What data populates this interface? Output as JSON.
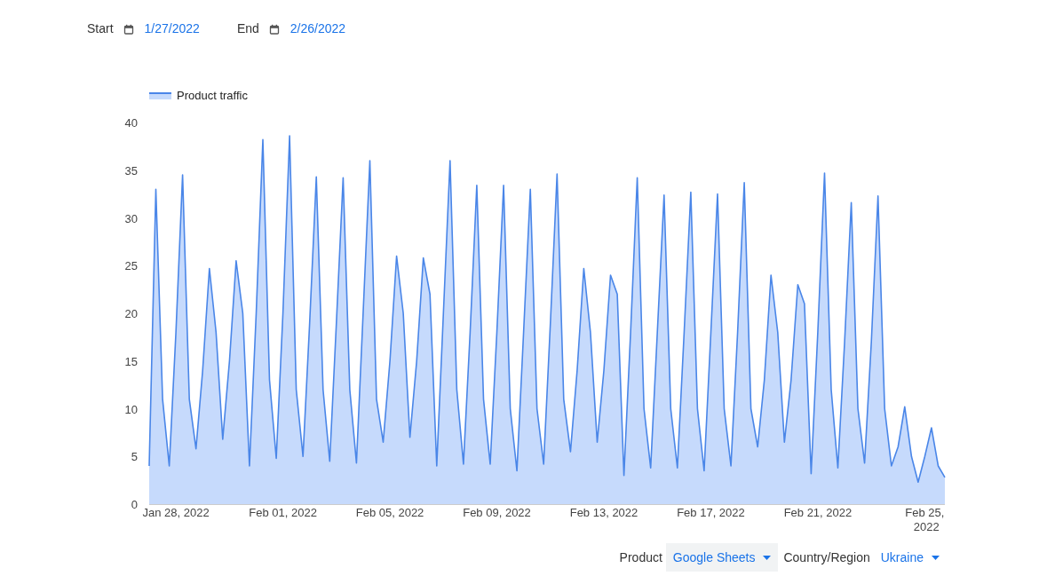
{
  "date_range": {
    "start_label": "Start",
    "start_value": "1/27/2022",
    "end_label": "End",
    "end_value": "2/26/2022"
  },
  "chart": {
    "chart_data": {
      "type": "area",
      "ylim": [
        0,
        40
      ],
      "yticks": [
        0,
        5,
        10,
        15,
        20,
        25,
        30,
        35,
        40
      ],
      "categories": [
        null,
        null,
        null,
        null,
        "Jan 28, 2022",
        null,
        null,
        null,
        null,
        null,
        null,
        null,
        null,
        null,
        null,
        null,
        null,
        null,
        null,
        null,
        "Feb 01, 2022",
        null,
        null,
        null,
        null,
        null,
        null,
        null,
        null,
        null,
        null,
        null,
        null,
        null,
        null,
        null,
        "Feb 05, 2022",
        null,
        null,
        null,
        null,
        null,
        null,
        null,
        null,
        null,
        null,
        null,
        null,
        null,
        null,
        null,
        "Feb 09, 2022",
        null,
        null,
        null,
        null,
        null,
        null,
        null,
        null,
        null,
        null,
        null,
        null,
        null,
        null,
        null,
        "Feb 13, 2022",
        null,
        null,
        null,
        null,
        null,
        null,
        null,
        null,
        null,
        null,
        null,
        null,
        null,
        null,
        null,
        "Feb 17, 2022",
        null,
        null,
        null,
        null,
        null,
        null,
        null,
        null,
        null,
        null,
        null,
        null,
        null,
        null,
        null,
        "Feb 21, 2022",
        null,
        null,
        null,
        null,
        null,
        null,
        null,
        null,
        null,
        null,
        null,
        null,
        null,
        null,
        null,
        "Feb 25, 2022",
        null,
        null,
        null
      ],
      "series": [
        {
          "name": "Product traffic",
          "color": "#4a86e8",
          "values": [
            4,
            33,
            11,
            4,
            18,
            34.5,
            11,
            5.8,
            14,
            24.7,
            18,
            6.8,
            15,
            25.5,
            20,
            4,
            20,
            38.2,
            13,
            4.8,
            20,
            38.6,
            12,
            5,
            19,
            34.3,
            12,
            4.5,
            19,
            34.2,
            12,
            4.3,
            20,
            36,
            11,
            6.5,
            15,
            26,
            20,
            7,
            15,
            25.8,
            22,
            4,
            20,
            36,
            12,
            4.2,
            18,
            33.4,
            11,
            4.2,
            18,
            33.4,
            10,
            3.5,
            18,
            33,
            10,
            4.2,
            19,
            34.6,
            11,
            5.5,
            14,
            24.7,
            18,
            6.5,
            14,
            24,
            22,
            3,
            18,
            34.2,
            10,
            3.8,
            18,
            32.4,
            10,
            3.8,
            18,
            32.7,
            10,
            3.5,
            18,
            32.5,
            10,
            4,
            18,
            33.7,
            10,
            6,
            13,
            24,
            18,
            6.5,
            13,
            23,
            21,
            3.2,
            18,
            34.7,
            12,
            3.8,
            17,
            31.6,
            10,
            4.3,
            17,
            32.3,
            10,
            4,
            6,
            10.2,
            5,
            2.3,
            5,
            8,
            4,
            2.8
          ]
        }
      ]
    }
  },
  "filters": [
    {
      "label": "Product",
      "value": "Google Sheets",
      "highlighted": true
    },
    {
      "label": "Country/Region",
      "value": "Ukraine",
      "highlighted": false
    }
  ]
}
